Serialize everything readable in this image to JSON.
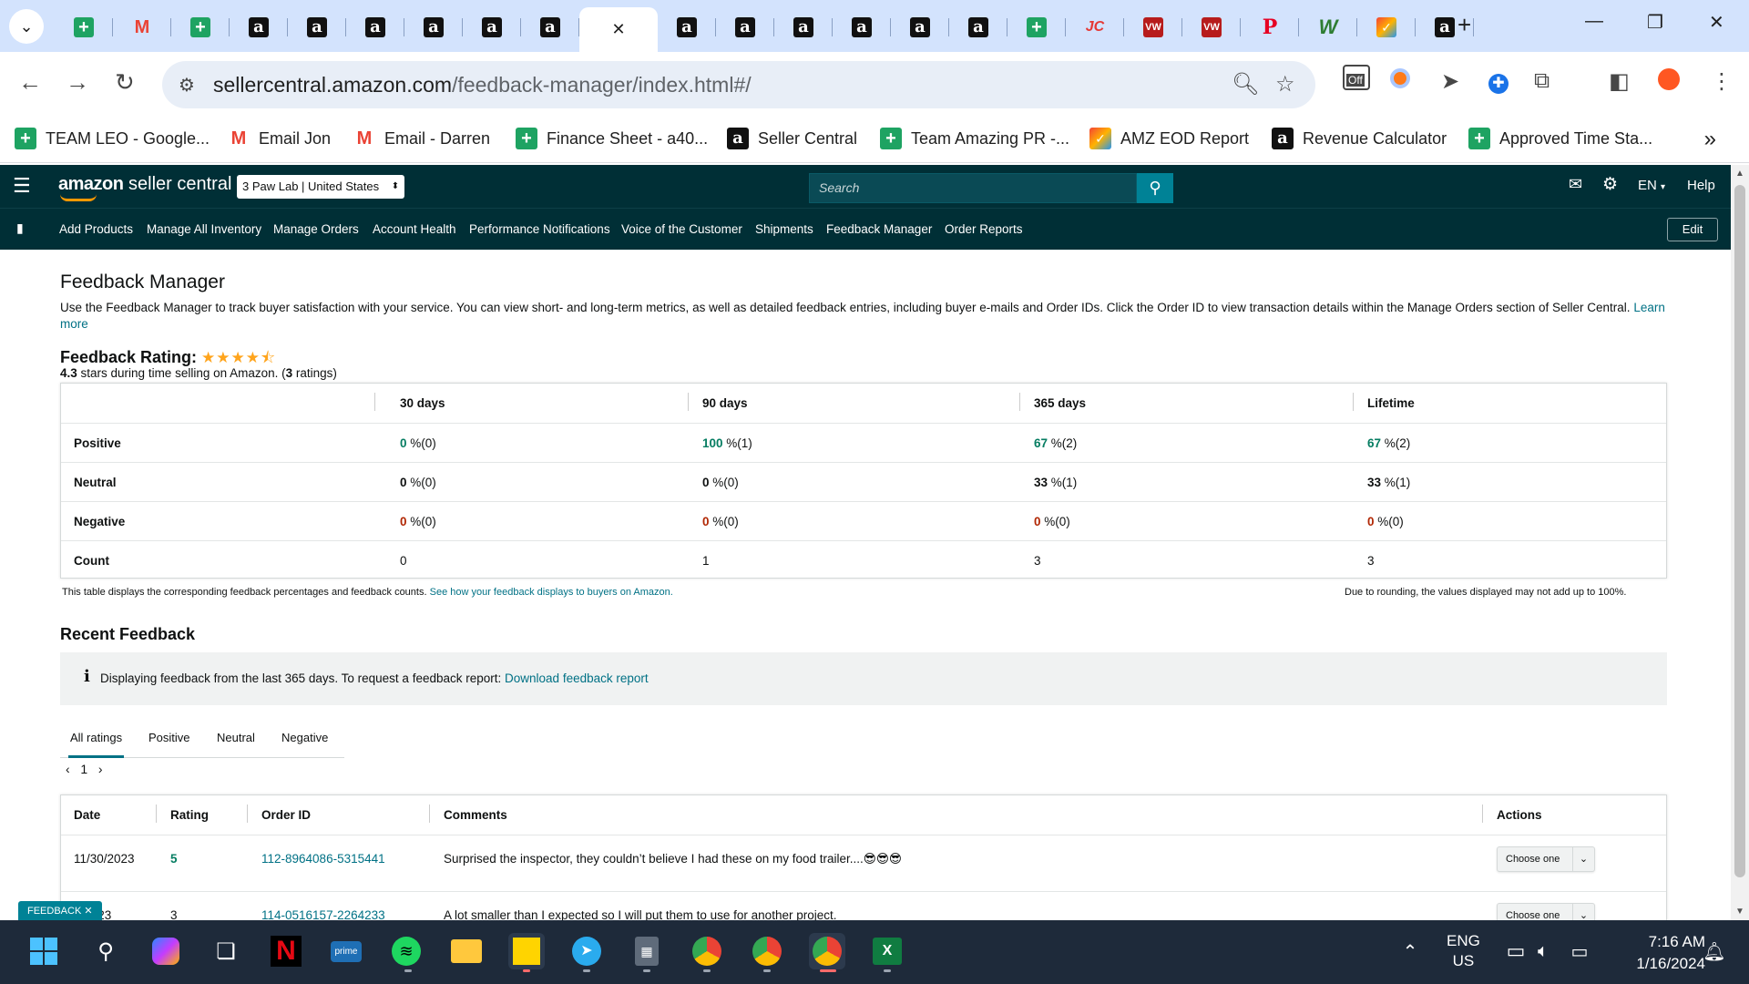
{
  "browser": {
    "omnibox": {
      "domain": "sellercentral.amazon.com",
      "path": "/feedback-manager/index.html#/"
    },
    "bookmarks": [
      {
        "label": "TEAM LEO - Google...",
        "icon": "sheets"
      },
      {
        "label": "Email Jon",
        "icon": "gmail"
      },
      {
        "label": "Email - Darren",
        "icon": "gmail"
      },
      {
        "label": "Finance Sheet - a40...",
        "icon": "sheets"
      },
      {
        "label": "Seller Central",
        "icon": "amazon"
      },
      {
        "label": "Team Amazing PR -...",
        "icon": "sheets"
      },
      {
        "label": "AMZ EOD Report",
        "icon": "multi"
      },
      {
        "label": "Revenue Calculator",
        "icon": "amazon"
      },
      {
        "label": "Approved Time Sta...",
        "icon": "sheets"
      }
    ],
    "extension_badge": "Off"
  },
  "header": {
    "logo_main": "amazon",
    "logo_sub": "seller central",
    "store": "3 Paw Lab | United States",
    "search_placeholder": "Search",
    "language": "EN",
    "help": "Help"
  },
  "nav": {
    "items": [
      "Add Products",
      "Manage All Inventory",
      "Manage Orders",
      "Account Health",
      "Performance Notifications",
      "Voice of the Customer",
      "Shipments",
      "Feedback Manager",
      "Order Reports"
    ],
    "edit": "Edit"
  },
  "page": {
    "title": "Feedback Manager",
    "intro": "Use the Feedback Manager to track buyer satisfaction with your service. You can view short- and long-term metrics, as well as detailed feedback entries, including buyer e-mails and Order IDs. Click the Order ID to view transaction details within the Manage Orders section of Seller Central.",
    "learn_more": "Learn more",
    "rating_label": "Feedback Rating:",
    "rating_stars": 4.3,
    "rating_value": "4.3",
    "rating_sub_mid": " stars during time selling on Amazon. (",
    "rating_count": "3",
    "rating_sub_end": " ratings)"
  },
  "metrics": {
    "columns": [
      "30 days",
      "90 days",
      "365 days",
      "Lifetime"
    ],
    "rows": [
      {
        "label": "Positive",
        "values": [
          [
            "0",
            " %(0)"
          ],
          [
            "100",
            " %(1)"
          ],
          [
            "67",
            " %(2)"
          ],
          [
            "67",
            " %(2)"
          ]
        ]
      },
      {
        "label": "Neutral",
        "values": [
          [
            "0",
            " %(0)"
          ],
          [
            "0",
            " %(0)"
          ],
          [
            "33",
            " %(1)"
          ],
          [
            "33",
            " %(1)"
          ]
        ]
      },
      {
        "label": "Negative",
        "values": [
          [
            "0",
            " %(0)"
          ],
          [
            "0",
            " %(0)"
          ],
          [
            "0",
            " %(0)"
          ],
          [
            "0",
            " %(0)"
          ]
        ]
      },
      {
        "label": "Count",
        "values": [
          [
            "0",
            ""
          ],
          [
            "1",
            ""
          ],
          [
            "3",
            ""
          ],
          [
            "3",
            ""
          ]
        ]
      }
    ],
    "note_left": "This table displays the corresponding feedback percentages and feedback counts.",
    "note_left_link": "See how your feedback displays to buyers on Amazon.",
    "note_right": "Due to rounding, the values displayed may not add up to 100%."
  },
  "recent": {
    "title": "Recent Feedback",
    "info_text": "Displaying feedback from the last 365 days. To request a feedback report:",
    "info_link": "Download feedback report",
    "tabs": [
      "All ratings",
      "Positive",
      "Neutral",
      "Negative"
    ],
    "page": "1",
    "columns": [
      "Date",
      "Rating",
      "Order ID",
      "Comments",
      "Actions"
    ],
    "rows": [
      {
        "date": "11/30/2023",
        "rating": "5",
        "order_id": "112-8964086-5315441",
        "comment": "Surprised the inspector, they couldn’t believe I had these on my food trailer....😎😎😎",
        "action": "Choose one"
      },
      {
        "date": "7/2023",
        "rating": "3",
        "order_id": "114-0516157-2264233",
        "comment": "A lot smaller than I expected so I will put them to use for another project.",
        "action": "Choose one"
      }
    ],
    "feedback_tab": "FEEDBACK ✕"
  },
  "taskbar": {
    "lang_top": "ENG",
    "lang_bottom": "US",
    "time": "7:16 AM",
    "date": "1/16/2024"
  },
  "colors": {
    "header_bg": "#002f36",
    "link": "#007185",
    "positive": "#067d62",
    "negative": "#b12704",
    "star": "#ffa41c"
  }
}
